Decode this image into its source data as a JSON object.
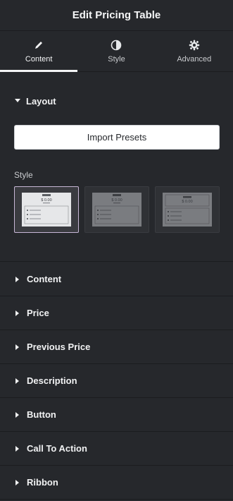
{
  "header": {
    "title": "Edit Pricing Table"
  },
  "tabs": [
    {
      "label": "Content",
      "icon": "pencil-icon",
      "active": true
    },
    {
      "label": "Style",
      "icon": "contrast-icon",
      "active": false
    },
    {
      "label": "Advanced",
      "icon": "gear-icon",
      "active": false
    }
  ],
  "layout": {
    "title": "Layout",
    "import_label": "Import Presets",
    "style_label": "Style",
    "presets": [
      {
        "price": "$ 0.00",
        "selected": true
      },
      {
        "price": "$ 0.00",
        "selected": false
      },
      {
        "price": "$ 0.00",
        "selected": false
      }
    ]
  },
  "sections": [
    {
      "label": "Content"
    },
    {
      "label": "Price"
    },
    {
      "label": "Previous Price"
    },
    {
      "label": "Description"
    },
    {
      "label": "Button"
    },
    {
      "label": "Call To Action"
    },
    {
      "label": "Ribbon"
    }
  ],
  "colors": {
    "panel": "#26282c",
    "divider": "#1b1c1f",
    "selected_border": "#c7b7d6"
  }
}
